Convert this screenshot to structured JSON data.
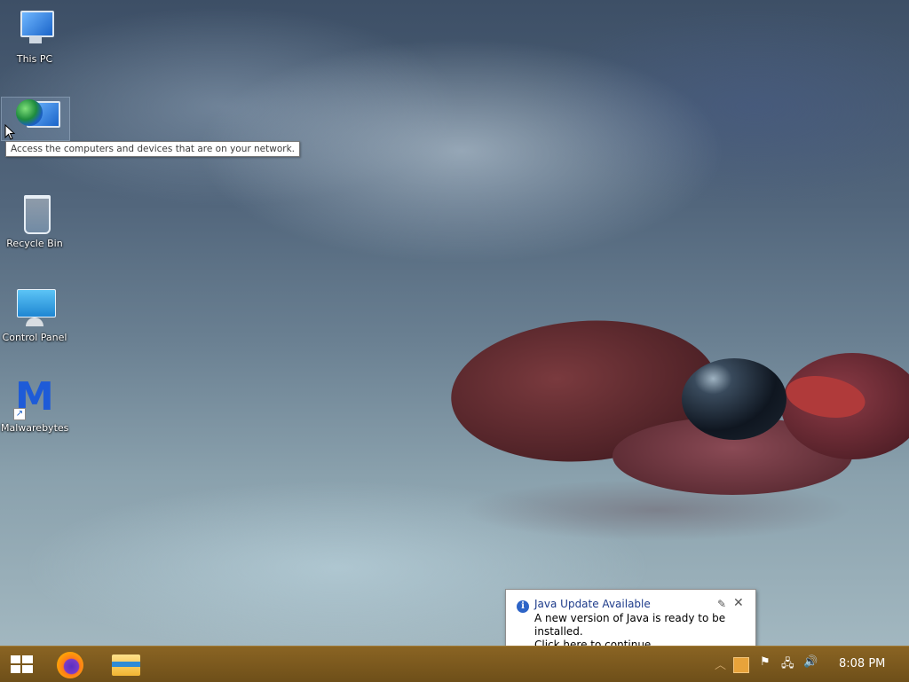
{
  "desktop": {
    "icons": [
      {
        "label": "This PC",
        "icon": "this-pc-icon"
      },
      {
        "label": "",
        "icon": "network-icon"
      },
      {
        "label": "Recycle Bin",
        "icon": "recycle-bin-icon"
      },
      {
        "label": "Control Panel",
        "icon": "control-panel-icon"
      },
      {
        "label": "Malwarebytes",
        "icon": "malwarebytes-icon"
      }
    ],
    "tooltip": "Access the computers and devices that are on your network."
  },
  "notification": {
    "title": "Java Update Available",
    "line1": "A new version of Java is ready to be installed.",
    "line2": "Click here to continue.",
    "options_glyph": "✎",
    "close_glyph": "✕"
  },
  "taskbar": {
    "start_icon": "windows-logo-icon",
    "apps": [
      {
        "name": "Firefox",
        "icon": "firefox-icon"
      },
      {
        "name": "File Explorer",
        "icon": "file-explorer-icon"
      }
    ],
    "tray": {
      "overflow_glyph": "︿",
      "flag_glyph": "⚑",
      "network_glyph": "🖧",
      "volume_glyph": "🔊"
    },
    "clock": "8:08 PM",
    "accent": "#7a5a1e"
  }
}
